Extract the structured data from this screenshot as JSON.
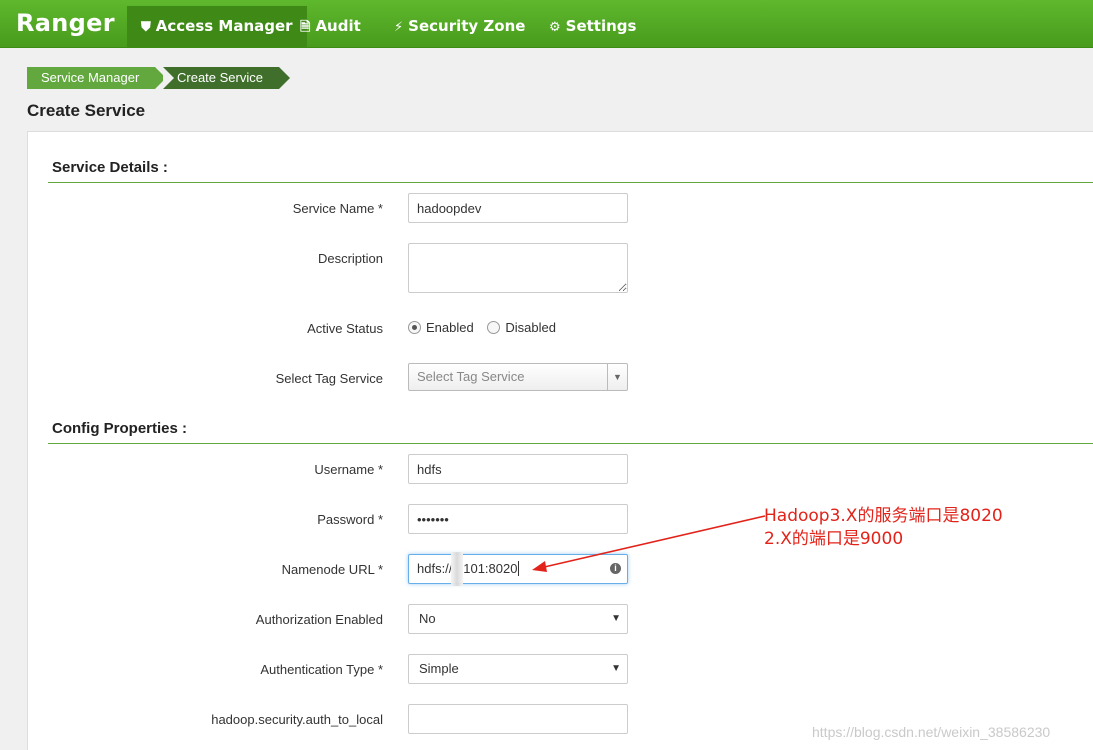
{
  "brand": "Ranger",
  "nav": {
    "access_manager": "Access Manager",
    "audit": "Audit",
    "security_zone": "Security Zone",
    "settings": "Settings"
  },
  "breadcrumb": [
    "Service Manager",
    "Create Service"
  ],
  "page_title": "Create Service",
  "service_details": {
    "title": "Service Details :",
    "service_name_label": "Service Name *",
    "service_name_value": "hadoopdev",
    "description_label": "Description",
    "description_value": "",
    "active_status_label": "Active Status",
    "enabled_label": "Enabled",
    "disabled_label": "Disabled",
    "active_status_selected": "Enabled",
    "tag_service_label": "Select Tag Service",
    "tag_service_placeholder": "Select Tag Service"
  },
  "config": {
    "title": "Config Properties :",
    "username_label": "Username *",
    "username_value": "hdfs",
    "password_label": "Password *",
    "password_value": "•••••••",
    "namenode_label": "Namenode URL *",
    "namenode_value": "hdfs://   101:8020",
    "authorization_label": "Authorization Enabled",
    "authorization_value": "No",
    "authentication_label": "Authentication Type *",
    "authentication_value": "Simple",
    "auth_to_local_label": "hadoop.security.auth_to_local",
    "auth_to_local_value": ""
  },
  "annotation": {
    "line1": "Hadoop3.X的服务端口是8020",
    "line2": "2.X的端口是9000",
    "color": "#e2231a"
  },
  "watermark": "https://blog.csdn.net/weixin_38586230"
}
